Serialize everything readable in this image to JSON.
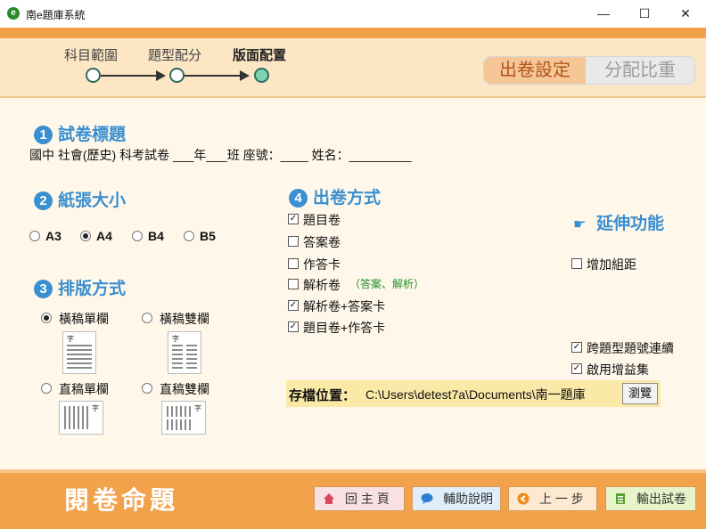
{
  "window": {
    "title": "南e題庫系統",
    "minimize": "—",
    "maximize": "☐",
    "close": "✕"
  },
  "steps": [
    {
      "label": "科目範圍"
    },
    {
      "label": "題型配分"
    },
    {
      "label": "版面配置"
    }
  ],
  "tabs": {
    "active": "出卷設定",
    "inactive": "分配比重"
  },
  "sections": {
    "title": {
      "num": "1",
      "heading": "試卷標題",
      "text": "國中 社會(歷史) 科考試卷  ___年___班  座號：____  姓名：_________"
    },
    "paper": {
      "num": "2",
      "heading": "紙張大小",
      "options": [
        "A3",
        "A4",
        "B4",
        "B5"
      ],
      "selected": "A4"
    },
    "layout": {
      "num": "3",
      "heading": "排版方式",
      "options": [
        "橫稿單欄",
        "橫稿雙欄",
        "直稿單欄",
        "直稿雙欄"
      ],
      "selected": "橫稿單欄",
      "thumb_char": "字"
    },
    "output": {
      "num": "4",
      "heading": "出卷方式",
      "items": [
        {
          "label": "題目卷",
          "checked": true
        },
        {
          "label": "答案卷",
          "checked": false
        },
        {
          "label": "作答卡",
          "checked": false
        },
        {
          "label": "解析卷",
          "checked": false,
          "note": "（答案、解析）"
        },
        {
          "label": "解析卷+答案卡",
          "checked": true
        },
        {
          "label": "題目卷+作答卡",
          "checked": true
        }
      ]
    },
    "ext": {
      "heading": "延伸功能",
      "items": [
        {
          "label": "增加組距",
          "checked": false
        },
        {
          "label": "跨題型題號連續",
          "checked": true
        },
        {
          "label": "啟用增益集",
          "checked": true
        }
      ]
    }
  },
  "save": {
    "label": "存檔位置：",
    "path": "C:\\Users\\detest7a\\Documents\\南一題庫",
    "browse": "瀏覽"
  },
  "footer": {
    "brand": "閱卷命題",
    "buttons": [
      {
        "label": "回 主 頁"
      },
      {
        "label": "輔助說明"
      },
      {
        "label": "上 一 步"
      },
      {
        "label": "輸出試卷"
      }
    ]
  },
  "colors": {
    "accent_orange": "#f2a24a",
    "heading_blue": "#3a8fd0",
    "header_bg": "#fde6c4",
    "body_bg": "#fff8ea"
  }
}
